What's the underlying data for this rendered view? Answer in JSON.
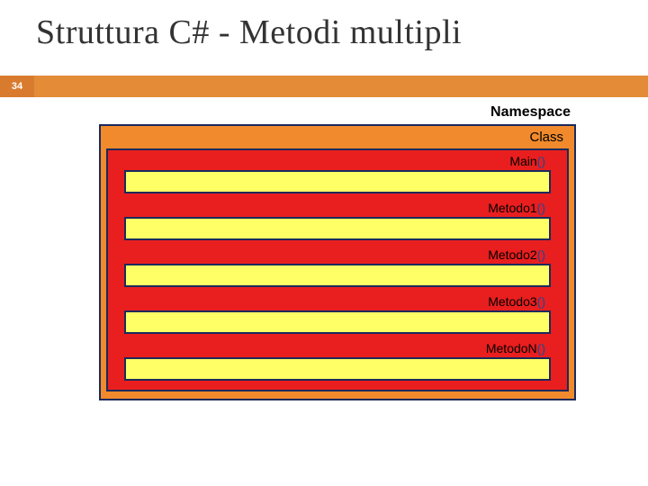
{
  "title": "Struttura C# - Metodi multipli",
  "page_number": "34",
  "namespace_label": "Namespace",
  "class_label": "Class",
  "methods": [
    {
      "name": "Main",
      "paren": "()"
    },
    {
      "name": "Metodo1",
      "paren": "()"
    },
    {
      "name": "Metodo2",
      "paren": "()"
    },
    {
      "name": "Metodo3",
      "paren": "()"
    },
    {
      "name": "MetodoN",
      "paren": "()"
    }
  ]
}
